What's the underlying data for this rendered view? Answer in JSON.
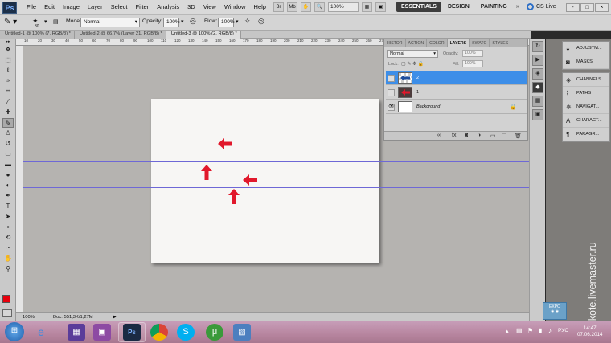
{
  "app": {
    "logo": "Ps"
  },
  "menu": [
    "File",
    "Edit",
    "Image",
    "Layer",
    "Select",
    "Filter",
    "Analysis",
    "3D",
    "View",
    "Window",
    "Help"
  ],
  "menubar": {
    "zoom": "100%",
    "workspaces": [
      "ESSENTIALS",
      "DESIGN",
      "PAINTING"
    ],
    "more": "»",
    "cslive": "CS Live",
    "window_controls": [
      "-",
      "□",
      "×"
    ]
  },
  "options": {
    "brush_size": "30",
    "mode_label": "Mode:",
    "mode_value": "Normal",
    "opacity_label": "Opacity:",
    "opacity_value": "100%",
    "flow_label": "Flow:",
    "flow_value": "100%"
  },
  "doc_tabs": [
    "Untitled-1 @ 100% (7, RGB/8) *",
    "Untitled-2 @ 66,7% (Layer 21, RGB/8) *",
    "Untitled-3 @ 100% (2, RGB/8) *"
  ],
  "rulers": {
    "top": [
      "10",
      "20",
      "30",
      "40",
      "50",
      "60",
      "70",
      "80",
      "90",
      "100",
      "110",
      "120",
      "130",
      "140",
      "150",
      "160",
      "170",
      "180",
      "190",
      "200",
      "210",
      "220",
      "230",
      "240",
      "250",
      "260",
      "270",
      "280",
      "290",
      "300",
      "310",
      "320",
      "330",
      "340",
      "350",
      "360",
      "370",
      "380"
    ]
  },
  "status": {
    "zoom": "100%",
    "doc": "Doc: 551,3K/1,27M",
    "arrow": "▶"
  },
  "layers_panel": {
    "tabs": [
      "HISTOR",
      "ACTION",
      "COLOR",
      "LAYERS",
      "SWATC",
      "STYLES"
    ],
    "blend_mode": "Normal",
    "opacity_label": "Opacity:",
    "opacity_value": "100%",
    "lock_label": "Lock:",
    "fill_label": "Fill:",
    "fill_value": "100%",
    "layers": [
      {
        "name": "2",
        "selected": true
      },
      {
        "name": "1",
        "selected": false
      },
      {
        "name": "Background",
        "selected": false,
        "locked": true
      }
    ],
    "footer_icons": [
      "link-icon",
      "fx-icon",
      "mask-icon",
      "adjustment-icon",
      "folder-icon",
      "new-layer-icon",
      "trash-icon"
    ]
  },
  "collapsed_panels": {
    "group1": [
      {
        "icon": "adjustments-icon",
        "label": "ADJUSTM..."
      },
      {
        "icon": "masks-icon",
        "label": "MASKS"
      }
    ],
    "group2": [
      {
        "icon": "channels-icon",
        "label": "CHANNELS"
      },
      {
        "icon": "paths-icon",
        "label": "PATHS"
      },
      {
        "icon": "navigator-icon",
        "label": "NAVIGAT..."
      },
      {
        "icon": "character-icon",
        "label": "CHARACT..."
      },
      {
        "icon": "paragraph-icon",
        "label": "PARAGR..."
      }
    ]
  },
  "overlay": {
    "watermark": "art-kote.livemaster.ru",
    "expo_badge": "EXPO"
  },
  "taskbar": {
    "language": "РУС",
    "time": "14:47",
    "date": "07.06.2014"
  },
  "colors": {
    "accent_selection": "#3d8ee8",
    "guide": "#6e68d6",
    "arrow_red": "#e1182b",
    "foreground_swatch": "#e8000d"
  }
}
